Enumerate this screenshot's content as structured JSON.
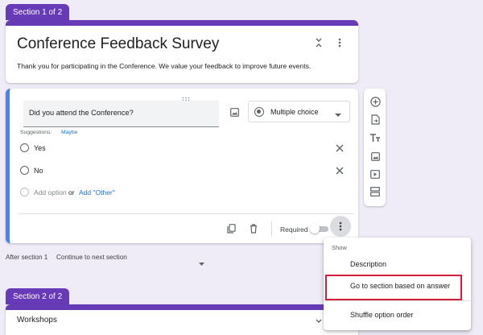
{
  "section1": {
    "tab_label": "Section 1 of 2",
    "title": "Conference Feedback Survey",
    "description": "Thank you for participating in the Conference. We value your feedback to improve future events."
  },
  "question": {
    "text": "Did you attend the Conference?",
    "type_label": "Multiple choice",
    "suggestions_label": "Suggestions:",
    "suggestion_value": "Maybe",
    "options": [
      {
        "label": "Yes"
      },
      {
        "label": "No"
      }
    ],
    "add_option_label": "Add option",
    "or_label": "or",
    "add_other_label": "Add \"Other\"",
    "required_label": "Required",
    "required_on": false
  },
  "after_section": {
    "label": "After section 1",
    "value": "Continue to next section"
  },
  "section2": {
    "tab_label": "Section 2 of 2",
    "title": "Workshops"
  },
  "menu": {
    "header": "Show",
    "items": [
      {
        "label": "Description"
      },
      {
        "label": "Go to section based on answer"
      },
      {
        "label": "Shuffle option order"
      }
    ]
  },
  "colors": {
    "accent": "#673ab7",
    "active_border": "#4285f4",
    "link": "#1a73e8",
    "highlight_box": "#d11c3a",
    "background": "#efebf7"
  },
  "icons": {
    "toolbar": [
      "add-question-icon",
      "import-questions-icon",
      "add-title-icon",
      "add-image-icon",
      "add-video-icon",
      "add-section-icon"
    ]
  }
}
